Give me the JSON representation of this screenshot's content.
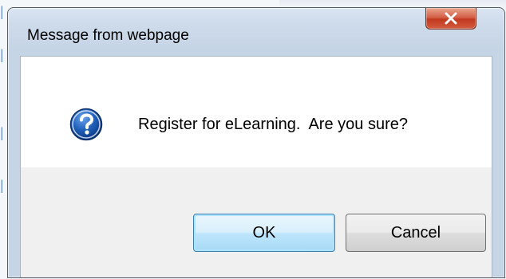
{
  "dialog": {
    "title": "Message from webpage",
    "message": "Register for eLearning.  Are you sure?",
    "icon": "question-icon",
    "buttons": {
      "ok_label": "OK",
      "cancel_label": "Cancel"
    }
  },
  "colors": {
    "close_button": "#c1391f",
    "question_icon": "#1f5fb8",
    "content_background": "#ffffff",
    "button_area_background": "#f0f0f0",
    "default_button_border": "#3c7fb1"
  }
}
